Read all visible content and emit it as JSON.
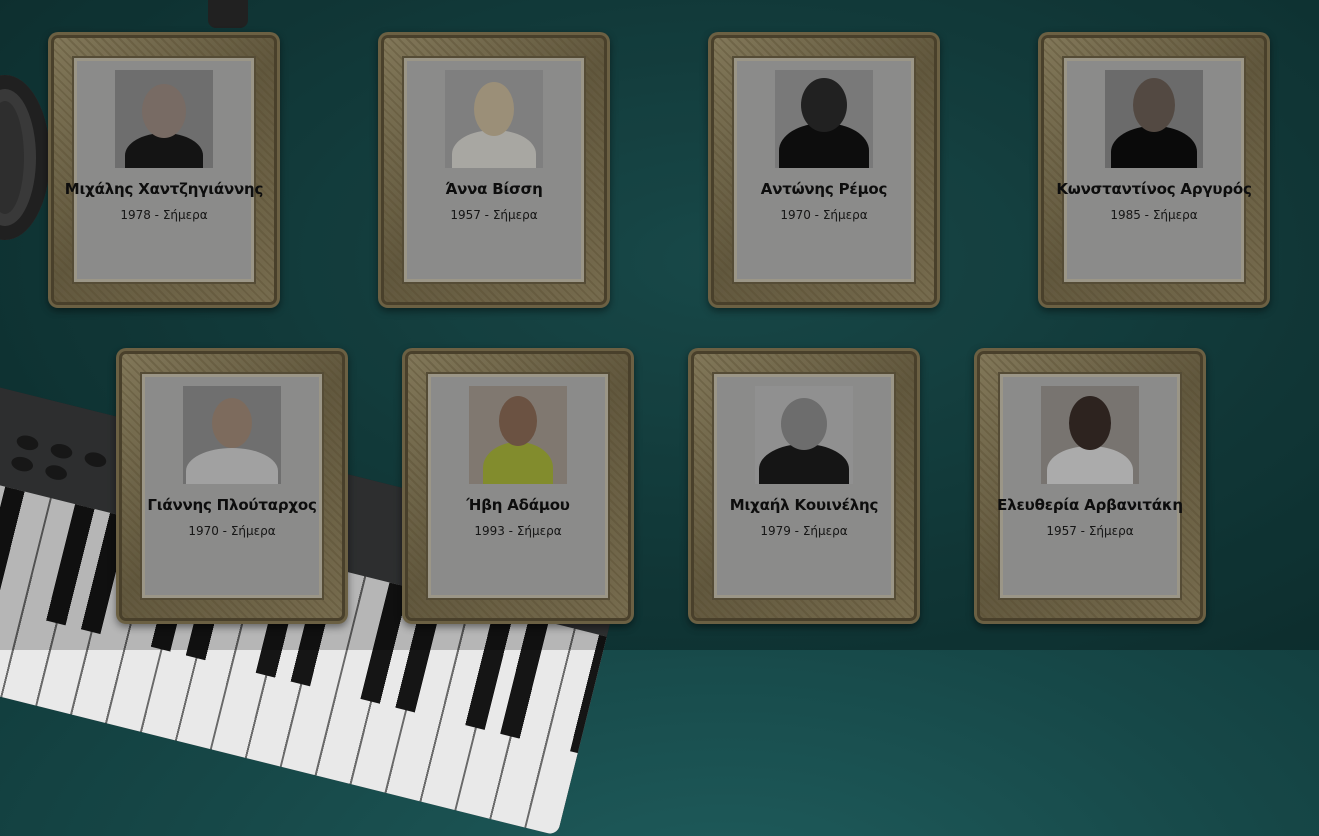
{
  "artists": [
    {
      "name": "Μιχάλης Χαντζηγιάννης",
      "years": "1978 - Σήμερα",
      "photo_icon": "artist-photo"
    },
    {
      "name": "Άννα Βίσση",
      "years": "1957 - Σήμερα",
      "photo_icon": "artist-photo"
    },
    {
      "name": "Αντώνης Ρέμος",
      "years": "1970 - Σήμερα",
      "photo_icon": "artist-photo"
    },
    {
      "name": "Κωνσταντίνος Αργυρός",
      "years": "1985 - Σήμερα",
      "photo_icon": "artist-photo"
    },
    {
      "name": "Γιάννης Πλούταρχος",
      "years": "1970 - Σήμερα",
      "photo_icon": "artist-photo"
    },
    {
      "name": "Ήβη Αδάμου",
      "years": "1993 - Σήμερα",
      "photo_icon": "artist-photo"
    },
    {
      "name": "Μιχαήλ Κουινέλης",
      "years": "1979 - Σήμερα",
      "photo_icon": "artist-photo"
    },
    {
      "name": "Ελευθερία Αρβανιτάκη",
      "years": "1957 - Σήμερα",
      "photo_icon": "artist-photo"
    }
  ],
  "colors": {
    "background": "#1f5d5d",
    "frame_gold": "#a89b74",
    "card_inner": "#b3b3b1"
  }
}
